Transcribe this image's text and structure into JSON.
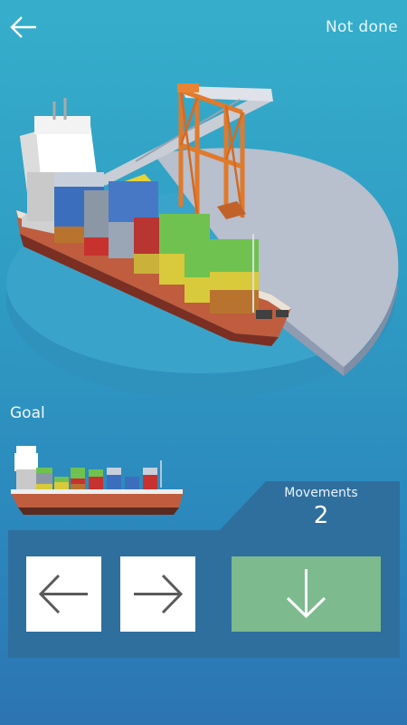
{
  "header": {
    "back_icon": "arrow-left-icon",
    "status_text": "Not done"
  },
  "goal": {
    "label": "Goal"
  },
  "stats": {
    "movements_label": "Movements",
    "movements_value": "2"
  },
  "controls": {
    "left_icon": "arrow-left-icon",
    "right_icon": "arrow-right-icon",
    "drop_icon": "arrow-down-icon"
  },
  "colors": {
    "panel": "#2f6f9e",
    "drop_button": "#7dba8d",
    "hull": "#b5573a",
    "platform": "#aab2c2",
    "crane": "#e07a2c"
  }
}
